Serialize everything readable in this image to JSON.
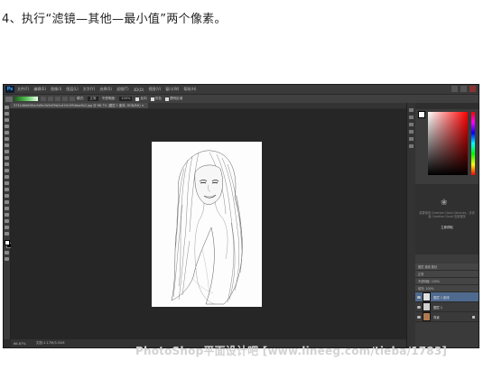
{
  "instruction": "4、执行“滤镜—其他—最小值”两个像素。",
  "photoshop": {
    "logo": "Ps",
    "menu": [
      "文件(F)",
      "编辑(E)",
      "图像(I)",
      "图层(L)",
      "文字(Y)",
      "选择(S)",
      "滤镜(T)",
      "3D(D)",
      "视图(V)",
      "窗口(W)",
      "帮助(H)"
    ],
    "options": {
      "mode_label": "模式:",
      "mode_value": "正常",
      "opacity_label": "不透明度:",
      "opacity_value": "100%",
      "reverse_label": "反向",
      "dither_label": "仿色",
      "transparency_label": "透明区域"
    },
    "document_tab": "5741d8d008cb5d9c2b5d09b2cd19c3ff1bba9b2.jpg @ 66.7% (图层 1 副本, RGB/8#) ×",
    "status": {
      "zoom": "66.67%",
      "doc_size": "文档:1.17M/3.52M"
    },
    "cc": {
      "text": "若要使用 Creative Cloud Libraries，请安装 Creative Cloud 应用程序",
      "link": "立即获取"
    },
    "layers_tab": "图层  通道  路径",
    "layer_mode": "正常",
    "layer_opacity_label": "不透明度: 100%",
    "layer_fill_label": "填充: 100%",
    "layers": [
      {
        "name": "图层 1 副本",
        "active": true
      },
      {
        "name": "图层 1",
        "active": false
      },
      {
        "name": "背景",
        "active": false
      }
    ]
  },
  "watermark": "PhotoShop平面设计吧  [www.lineeg.com/tieba/1783]"
}
